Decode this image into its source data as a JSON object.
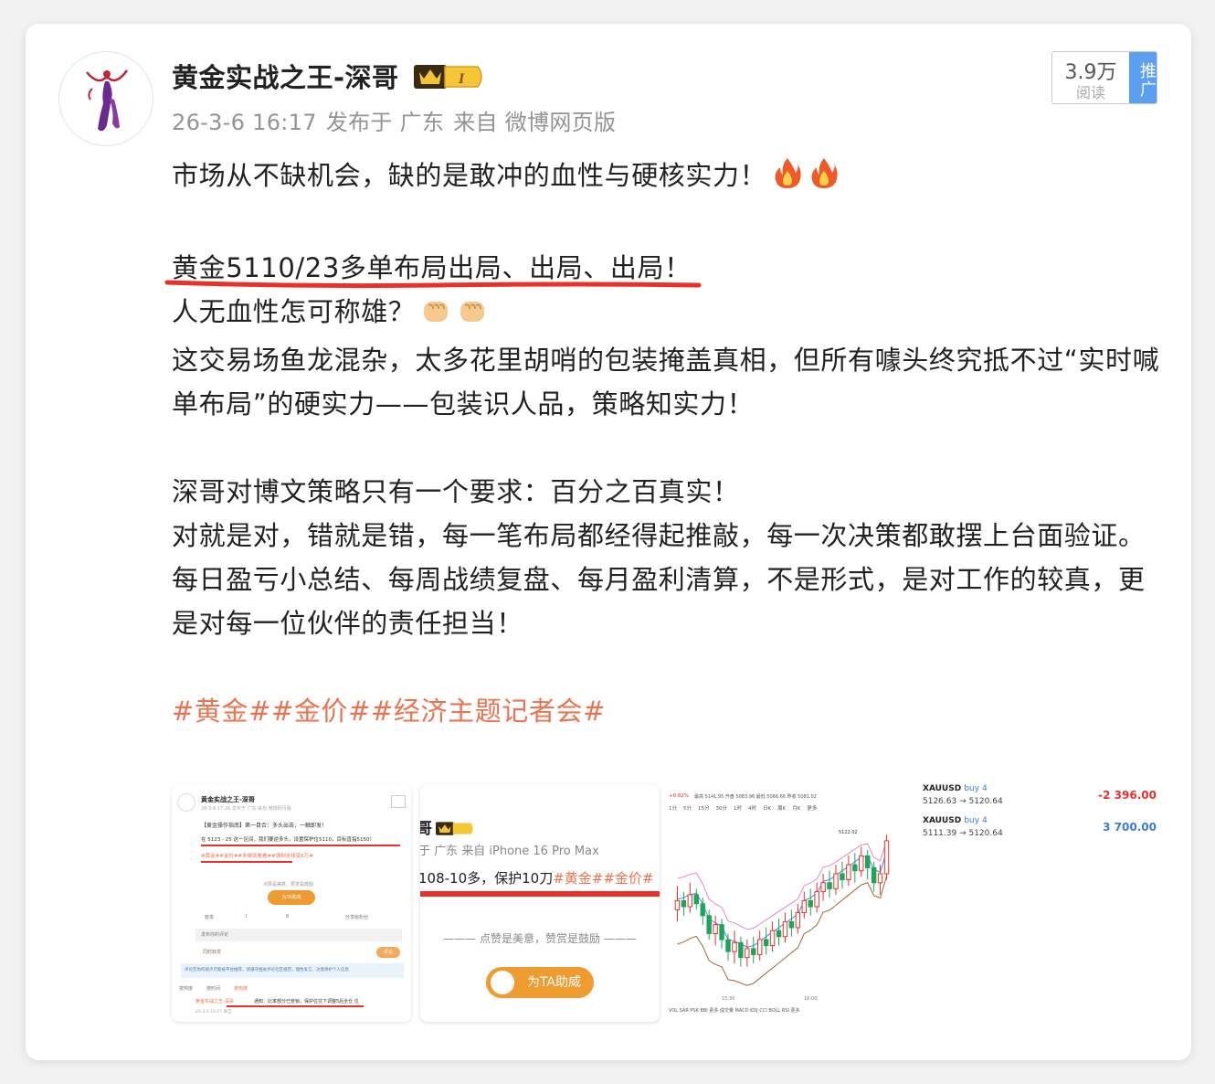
{
  "post": {
    "author": "黄金实战之王-深哥",
    "vip_level": "I",
    "date": "26-3-6 16:17",
    "posted_from": "发布于 广东",
    "source": "来自 微博网页版",
    "reads_count": "3.9万",
    "reads_label": "阅读",
    "promote_label": "推广"
  },
  "content": {
    "line1": "市场从不缺机会，缺的是敢冲的血性与硬核实力！",
    "line2": "黄金5110/23多单布局出局、出局、出局！",
    "line3": "人无血性怎可称雄？",
    "line4": "这交易场鱼龙混杂，太多花里胡哨的包装掩盖真相，但所有噱头终究抵不过“实时喊单布局”的硬实力——包装识人品，策略知实力！",
    "line5": "深哥对博文策略只有一个要求：百分之百真实！",
    "line6": "对就是对，错就是错，每一笔布局都经得起推敲，每一次决策都敢摆上台面验证。",
    "line7": "每日盈亏小总结、每周战绩复盘、每月盈利清算，不是形式，是对工作的较真，更是对每一位伙伴的责任担当！",
    "hashtags": "#黄金##金价##经济主题记者会#"
  },
  "thumb1": {
    "author": "黄金实战之王-深哥",
    "date": "26-3-6 17:26  发布于 广东 来自 微博网页版",
    "line1": "【黄金操作指南】第一目合：多头出击，一触即发！",
    "line2": "在 5123 - 25 这一区间，我们要逆多头，设置保护位5110，目标直指5150！",
    "tags": "#黄金##金价##多做就看看##强制全球变6万#",
    "like": "点赞是美意，赞赏是鼓励",
    "cheer": "为TA助威",
    "repost": "转发",
    "comment": "1",
    "likes": "8",
    "share": "分享给粉丝",
    "comment_placeholder": "发布你的评论",
    "also_repost": "同时转发",
    "send": "评论",
    "notice": "评论区你的观点可能被平台推荐，请遵守相关评论社区规范，理性发言，注意保护个人信息",
    "tab1": "按热度",
    "tab2": "按时间",
    "tab3": "按热度",
    "reply_author": "黄金实战之王-深哥",
    "reply_text": "通知：比率部分已管锁，保护位往下调整5后全仓 位",
    "reply_date": "26-3-6 16:07 来自"
  },
  "thumb2": {
    "name_fragment": "哥",
    "source": "于 广东  来自 iPhone 16 Pro Max",
    "text": "108-10多，保护10刀",
    "tags": "#黄金##金价#",
    "like": "点赞是美意，赞赏是鼓励",
    "cheer": "为TA助威"
  },
  "thumb3": {
    "change": "+0.82%",
    "hl_text": "最高 5141.95  开盘 5083.96  最低 5066.66  昨收 5081.02",
    "timeframes": [
      "1分",
      "5分",
      "15分",
      "30分",
      "1时",
      "4时",
      "日K",
      "周K",
      "月K",
      "更多"
    ],
    "top_label": "5122.02",
    "time1": "15:30",
    "time2": "16:00",
    "indicators": "VOL  SAR  PSK  BBI  更多   成交量  MACD  KDJ  CCI  BOLL  RSI  更多",
    "chart_data": {
      "type": "candlestick",
      "note": "approximate",
      "candles": [
        [
          5098,
          5101,
          5094,
          5106
        ],
        [
          5101,
          5099,
          5096,
          5104
        ],
        [
          5099,
          5103,
          5097,
          5107
        ],
        [
          5103,
          5100,
          5098,
          5105
        ],
        [
          5100,
          5096,
          5093,
          5102
        ],
        [
          5096,
          5090,
          5088,
          5098
        ],
        [
          5090,
          5093,
          5086,
          5096
        ],
        [
          5093,
          5088,
          5085,
          5095
        ],
        [
          5088,
          5084,
          5081,
          5090
        ],
        [
          5084,
          5087,
          5080,
          5091
        ],
        [
          5087,
          5082,
          5079,
          5089
        ],
        [
          5082,
          5085,
          5079,
          5088
        ],
        [
          5085,
          5083,
          5080,
          5089
        ],
        [
          5083,
          5088,
          5081,
          5091
        ],
        [
          5088,
          5086,
          5083,
          5092
        ],
        [
          5086,
          5091,
          5084,
          5094
        ],
        [
          5091,
          5089,
          5086,
          5095
        ],
        [
          5089,
          5094,
          5087,
          5097
        ],
        [
          5094,
          5092,
          5089,
          5098
        ],
        [
          5092,
          5097,
          5090,
          5100
        ],
        [
          5097,
          5101,
          5095,
          5104
        ],
        [
          5101,
          5099,
          5096,
          5105
        ],
        [
          5099,
          5104,
          5097,
          5107
        ],
        [
          5104,
          5107,
          5101,
          5110
        ],
        [
          5107,
          5105,
          5102,
          5111
        ],
        [
          5105,
          5110,
          5103,
          5113
        ],
        [
          5110,
          5108,
          5105,
          5114
        ],
        [
          5108,
          5113,
          5106,
          5116
        ],
        [
          5113,
          5111,
          5107,
          5117
        ],
        [
          5111,
          5116,
          5109,
          5119
        ],
        [
          5116,
          5112,
          5108,
          5118
        ],
        [
          5112,
          5107,
          5104,
          5114
        ],
        [
          5107,
          5110,
          5103,
          5113
        ],
        [
          5110,
          5121,
          5108,
          5123
        ]
      ]
    }
  },
  "thumb4": {
    "rows": [
      {
        "symbol": "XAUUSD",
        "side": "buy 4",
        "prices": "5126.63 → 5120.64",
        "pl": "-2 396.00",
        "pl_color": "#e8312a"
      },
      {
        "symbol": "XAUUSD",
        "side": "buy 4",
        "prices": "5111.39 → 5120.64",
        "pl": "3 700.00",
        "pl_color": "#3d7bd8"
      }
    ]
  },
  "colors": {
    "accent": "#eb7350",
    "underline": "#e8312a",
    "promo": "#5a9ff0"
  }
}
